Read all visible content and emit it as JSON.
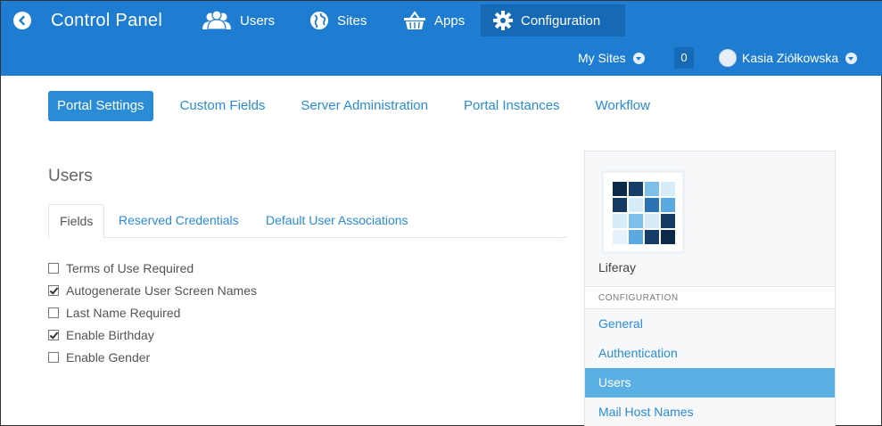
{
  "header": {
    "title": "Control Panel",
    "nav": [
      {
        "label": "Users",
        "icon": "users-icon"
      },
      {
        "label": "Sites",
        "icon": "globe-icon"
      },
      {
        "label": "Apps",
        "icon": "basket-icon"
      },
      {
        "label": "Configuration",
        "icon": "gear-icon"
      }
    ],
    "my_sites": "My Sites",
    "notifications": "0",
    "user_name": "Kasia Ziółkowska",
    "bar_color": "#1f7dd1"
  },
  "subtabs": [
    "Portal Settings",
    "Custom Fields",
    "Server Administration",
    "Portal Instances",
    "Workflow"
  ],
  "section": {
    "title": "Users",
    "tabs": [
      "Fields",
      "Reserved Credentials",
      "Default User Associations"
    ],
    "checkboxes": [
      {
        "label": "Terms of Use Required",
        "checked": false
      },
      {
        "label": "Autogenerate User Screen Names",
        "checked": true
      },
      {
        "label": "Last Name Required",
        "checked": false
      },
      {
        "label": "Enable Birthday",
        "checked": true
      },
      {
        "label": "Enable Gender",
        "checked": false
      }
    ]
  },
  "panel": {
    "site_name": "Liferay",
    "header": "CONFIGURATION",
    "links": [
      "General",
      "Authentication",
      "Users",
      "Mail Host Names"
    ],
    "active_link": "Users"
  }
}
